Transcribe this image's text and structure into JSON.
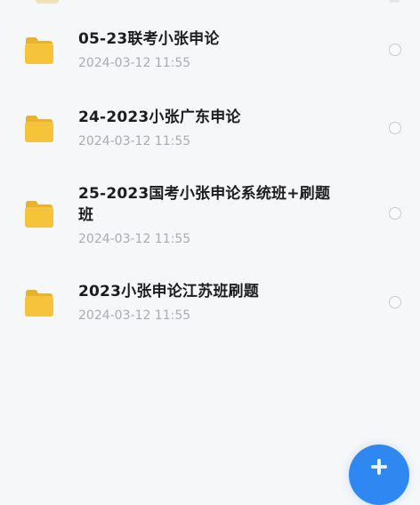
{
  "files": [
    {
      "name": "05-23联考小张申论",
      "date": "2024-03-12 11:55",
      "icon": "folder-icon"
    },
    {
      "name": "24-2023小张广东申论",
      "date": "2024-03-12 11:55",
      "icon": "folder-icon"
    },
    {
      "name": "25-2023国考小张申论系统班+刷题班",
      "date": "2024-03-12 11:55",
      "icon": "folder-icon"
    },
    {
      "name": "2023小张申论江苏班刷题",
      "date": "2024-03-12 11:55",
      "icon": "folder-icon"
    }
  ],
  "fab": {
    "icon": "plus-icon"
  },
  "colors": {
    "folder": "#f5c43a",
    "folder_tab": "#e9b22c",
    "date_text": "#a9adb3",
    "name_text": "#1d1d1f",
    "fab": "#2f88f2",
    "background": "#f6f7f9"
  }
}
